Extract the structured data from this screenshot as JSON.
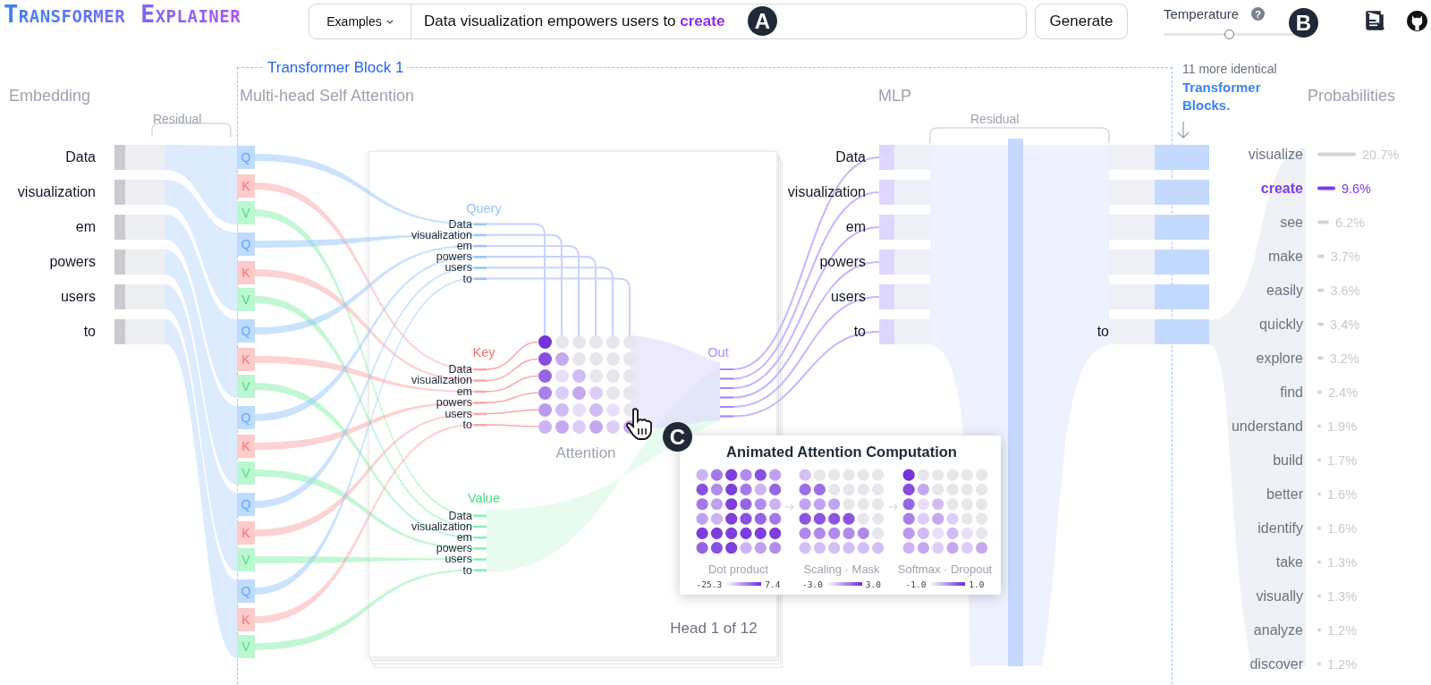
{
  "header": {
    "logo": "Transformer Explainer",
    "examples_button": "Examples",
    "prompt": "Data visualization empowers users to **create**",
    "generate_button": "Generate",
    "temperature": {
      "label": "Temperature",
      "help_mark": "?",
      "level": 0.5
    },
    "badges": [
      "A",
      "B"
    ]
  },
  "block": {
    "title": "Transformer Block 1"
  },
  "sections": {
    "embedding": "Embedding",
    "attention": "Multi-head Self Attention",
    "mlp": "MLP",
    "more_blocks_note": "11 more identical",
    "more_blocks_link": "Transformer Blocks.",
    "probabilities": "Probabilities"
  },
  "residual_labels": [
    "Residual",
    "Residual"
  ],
  "tokens": [
    "Data",
    "visualization",
    "em",
    "powers",
    "users",
    "to"
  ],
  "qkv_groups": [
    [
      "Q",
      "K",
      "V"
    ],
    [
      "Q",
      "K",
      "V"
    ],
    [
      "Q",
      "K",
      "V"
    ],
    [
      "Q",
      "K",
      "V"
    ],
    [
      "Q",
      "K",
      "V"
    ],
    [
      "Q",
      "K",
      "V"
    ]
  ],
  "head": {
    "query_label": "Query",
    "query_tokens": [
      "Data",
      "visualization",
      "em",
      "powers",
      "users",
      "to"
    ],
    "key_label": "Key",
    "key_tokens": [
      "Data",
      "visualization",
      "em",
      "powers",
      "users",
      "to"
    ],
    "value_label": "Value",
    "value_tokens": [
      "Data",
      "visualization",
      "em",
      "powers",
      "users",
      "to"
    ],
    "attention_label": "Attention",
    "out_label": "Out",
    "head_counter": "Head 1 of 12"
  },
  "mlp_tokens": [
    "Data",
    "visualization",
    "em",
    "powers",
    "users",
    "to"
  ],
  "mlp_output_token": "to",
  "probabilities": {
    "chart_data": {
      "type": "bar",
      "orientation": "horizontal",
      "categories": [
        "visualize",
        "create",
        "see",
        "make",
        "easily",
        "quickly",
        "explore",
        "find",
        "understand",
        "build",
        "better",
        "identify",
        "take",
        "visually",
        "analyze",
        "discover"
      ],
      "series": [
        {
          "color": "#d1d5db",
          "values": [
            20.7,
            null,
            6.2,
            3.7,
            3.6,
            3.4,
            3.2,
            2.4,
            1.9,
            1.7,
            1.6,
            1.6,
            1.3,
            1.3,
            1.2,
            1.2
          ],
          "value_labels": [
            "20.7%",
            null,
            "6.2%",
            "3.7%",
            "3.6%",
            "3.4%",
            "3.2%",
            "2.4%",
            "1.9%",
            "1.7%",
            "1.6%",
            "1.6%",
            "1.3%",
            "1.3%",
            "1.2%",
            "1.2%"
          ]
        },
        {
          "color": "#7c3aed",
          "values": [
            null,
            9.6,
            null,
            null,
            null,
            null,
            null,
            null,
            null,
            null,
            null,
            null,
            null,
            null,
            null,
            null
          ],
          "value_labels": [
            null,
            "9.6%",
            null,
            null,
            null,
            null,
            null,
            null,
            null,
            null,
            null,
            null,
            null,
            null,
            null,
            null
          ]
        }
      ],
      "data_labels": true
    },
    "rows": [
      {
        "selected": false
      },
      {
        "selected": true
      },
      {
        "selected": false
      },
      {
        "selected": false
      },
      {
        "selected": false
      },
      {
        "selected": false
      },
      {
        "selected": false
      },
      {
        "selected": false
      },
      {
        "selected": false
      },
      {
        "selected": false
      },
      {
        "selected": false
      },
      {
        "selected": false
      },
      {
        "selected": false
      },
      {
        "selected": false
      },
      {
        "selected": false
      },
      {
        "selected": false
      }
    ]
  },
  "popup": {
    "title": "Animated Attention Computation",
    "badge": "C",
    "stages": [
      {
        "kind": "raw",
        "label": "Dot product",
        "min": "-25.3",
        "max": "7.4"
      },
      {
        "kind": "scaled",
        "label": "Scaling · Mask",
        "min": "-3.0",
        "max": "3.0"
      },
      {
        "kind": "softmax",
        "label": "Softmax · Dropout",
        "min": "-1.0",
        "max": "1.0"
      }
    ]
  }
}
